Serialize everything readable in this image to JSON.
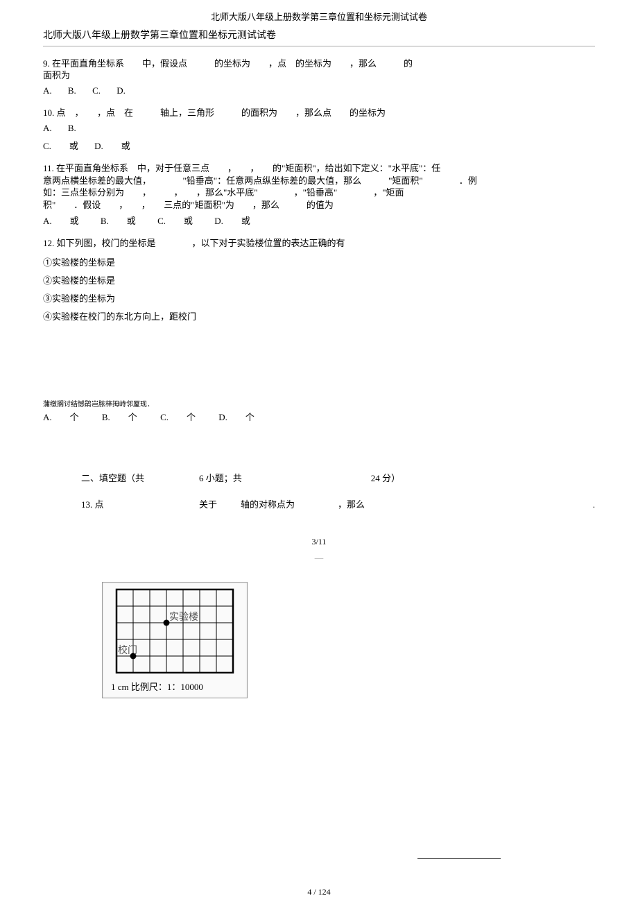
{
  "header": "北师大版八年级上册数学第三章位置和坐标元测试试卷",
  "subtitle": "北师大版八年级上册数学第三章位置和坐标元测试试卷",
  "q9": {
    "line1": "9. 在平面直角坐标系　　中，假设点　　　的坐标为　　，点　的坐标为　　，那么　　　的",
    "line2": "面积为",
    "opts": {
      "A": "A.",
      "B": "B.",
      "C": "C.",
      "D": "D."
    }
  },
  "q10": {
    "line1": "10. 点　，　　，点　在　　　轴上，三角形　　　的面积为　　，那么点　　的坐标为",
    "optsAB": {
      "A": "A.",
      "B": "B."
    },
    "optsCD": {
      "C": "C.　　或",
      "D": "D.　　或"
    }
  },
  "q11": {
    "l1": "11. 在平面直角坐标系　中，对于任意三点　　，　　，　　的\"矩面积\"，给出如下定义：\"水平底\"：任",
    "l2": "意两点横坐标差的最大值，　　　　\"铅垂高\"：任意两点纵坐标差的最大值，那么　　　\"矩面积\"　　　　．例",
    "l3": "如：三点坐标分别为　　，　　　，　　，那么\"水平底\"　　　　，\"铅垂高\"　　　　，\"矩面",
    "l4": "积\"　　．假设　　，　　，　　三点的\"矩面积\"为　　，那么　　　的值为",
    "opts": {
      "A": "A.　　或",
      "B": "B.　　或",
      "C": "C.　　或",
      "D": "D.　　或"
    }
  },
  "q12": {
    "head": "12. 如下列图，校门的坐标是　　　　，以下对于实验楼位置的表达正确的有",
    "s1": "①实验楼的坐标是",
    "s2": "②实验楼的坐标是",
    "s3": "③实验楼的坐标为",
    "s4": "④实验楼在校门的东北方向上，距校门",
    "garbled": "蒲缴搁讨结憾鹃岂脓梓拇峙邻厦现．",
    "opts": {
      "A": "A.　　个",
      "B": "B.　　个",
      "C": "C.　　个",
      "D": "D.　　个"
    }
  },
  "section2": {
    "title_a": "二、填空题（共",
    "title_b": "6 小题；共",
    "title_c": "24 分）",
    "q13_a": "13. 点",
    "q13_b": "关于",
    "q13_c": "轴的对称点为",
    "q13_d": "，那么",
    "q13_e": "."
  },
  "pager": "3/11",
  "figure": {
    "lab1": "实验楼",
    "lab2": "校门",
    "caption": "1 cm  比例尺：1：10000"
  },
  "pagenum": "4 / 124"
}
